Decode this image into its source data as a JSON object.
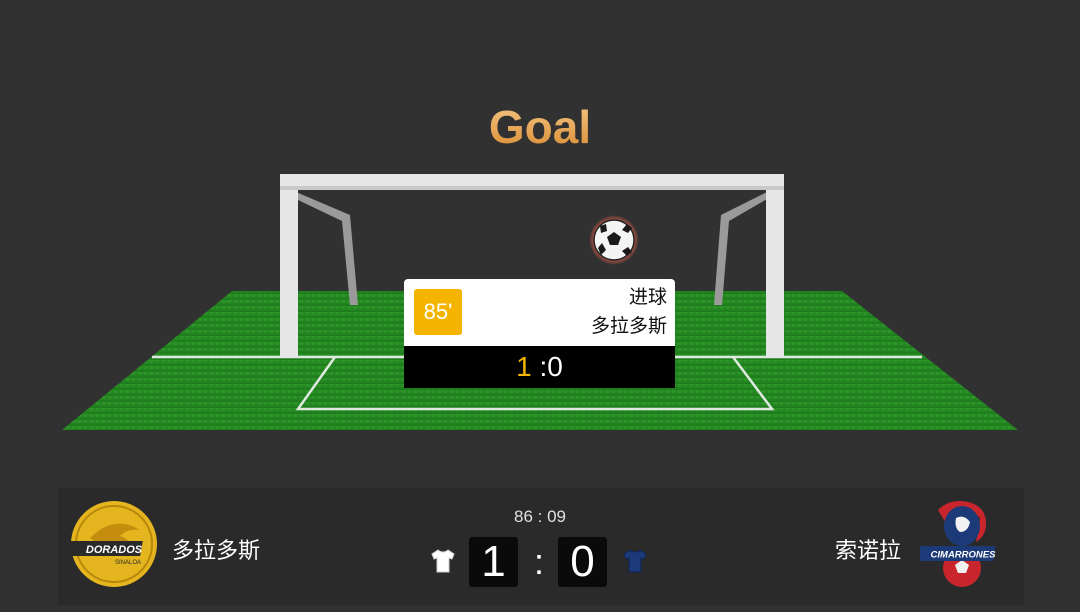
{
  "header": {
    "title": "Goal"
  },
  "event": {
    "minute": "85'",
    "type": "进球",
    "team": "多拉多斯",
    "score_home": "1",
    "score_sep": " :",
    "score_away": "0"
  },
  "match": {
    "clock": "86 : 09",
    "home": {
      "name": "多拉多斯",
      "score": "1",
      "jersey_color": "#ffffff",
      "logo_text": "DORADOS",
      "logo_subtext": "SINALOA",
      "logo_color": "#e4b51e"
    },
    "away": {
      "name": "索诺拉",
      "score": "0",
      "jersey_color": "#1c3a7a",
      "logo_text": "CIMARRONES",
      "logo_color": "#c8262c"
    },
    "separator": ":"
  },
  "colors": {
    "accent": "#f4b400",
    "pitch": "#2f9a2b",
    "background": "#313131"
  },
  "icons": [
    "soccer-ball-icon",
    "home-jersey-icon",
    "away-jersey-icon"
  ]
}
